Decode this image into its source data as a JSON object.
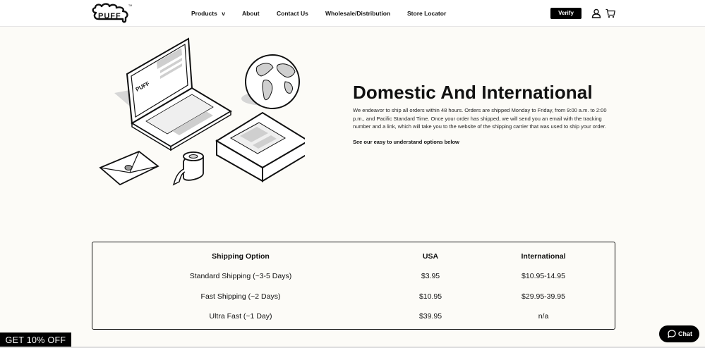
{
  "brand": {
    "logo_text": "PUFF",
    "trademark": "TM"
  },
  "nav": {
    "items": [
      {
        "label": "Products",
        "has_dropdown": true,
        "chevron": "v"
      },
      {
        "label": "About"
      },
      {
        "label": "Contact Us"
      },
      {
        "label": "Wholesale/Distribution"
      },
      {
        "label": "Store Locator"
      }
    ],
    "verify_label": "Verify",
    "icons": [
      "user-icon",
      "cart-icon",
      "chevron-down-icon"
    ]
  },
  "section": {
    "heading": "Domestic And International",
    "body": "We endeavor to ship all orders within 48 hours. Orders are shipped Monday to Friday, from 9:00 a.m. to 2:00 p.m., and Pacific Standard Time. Once your order has shipped, we will send you an email with the tracking number and a link, which will take you to the website of the shipping carrier that was used to ship your order.",
    "options_link": "See our easy to understand options below"
  },
  "shipping_table": {
    "headers": [
      "Shipping Option",
      "USA",
      "International"
    ],
    "rows": [
      [
        "Standard Shipping (~3-5 Days)",
        "$3.95",
        "$10.95-14.95"
      ],
      [
        "Fast Shipping (~2 Days)",
        "$10.95",
        "$29.95-39.95"
      ],
      [
        "Ultra Fast (~1 Day)",
        "$39.95",
        "n/a"
      ]
    ]
  },
  "promo": {
    "label": "GET 10% OFF"
  },
  "chat": {
    "label": "Chat"
  },
  "colors": {
    "background": "#fcfbf7",
    "primary": "#000000",
    "text": "#111111"
  }
}
